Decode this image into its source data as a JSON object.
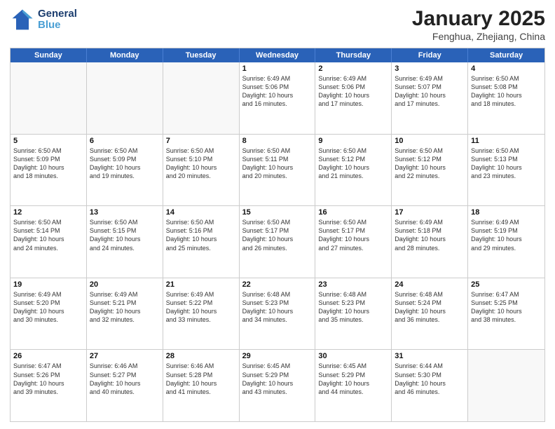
{
  "header": {
    "logo_line1": "General",
    "logo_line2": "Blue",
    "month": "January 2025",
    "location": "Fenghua, Zhejiang, China"
  },
  "weekdays": [
    "Sunday",
    "Monday",
    "Tuesday",
    "Wednesday",
    "Thursday",
    "Friday",
    "Saturday"
  ],
  "rows": [
    [
      {
        "day": "",
        "info": "",
        "empty": true
      },
      {
        "day": "",
        "info": "",
        "empty": true
      },
      {
        "day": "",
        "info": "",
        "empty": true
      },
      {
        "day": "1",
        "info": "Sunrise: 6:49 AM\nSunset: 5:06 PM\nDaylight: 10 hours\nand 16 minutes."
      },
      {
        "day": "2",
        "info": "Sunrise: 6:49 AM\nSunset: 5:06 PM\nDaylight: 10 hours\nand 17 minutes."
      },
      {
        "day": "3",
        "info": "Sunrise: 6:49 AM\nSunset: 5:07 PM\nDaylight: 10 hours\nand 17 minutes."
      },
      {
        "day": "4",
        "info": "Sunrise: 6:50 AM\nSunset: 5:08 PM\nDaylight: 10 hours\nand 18 minutes."
      }
    ],
    [
      {
        "day": "5",
        "info": "Sunrise: 6:50 AM\nSunset: 5:09 PM\nDaylight: 10 hours\nand 18 minutes."
      },
      {
        "day": "6",
        "info": "Sunrise: 6:50 AM\nSunset: 5:09 PM\nDaylight: 10 hours\nand 19 minutes."
      },
      {
        "day": "7",
        "info": "Sunrise: 6:50 AM\nSunset: 5:10 PM\nDaylight: 10 hours\nand 20 minutes."
      },
      {
        "day": "8",
        "info": "Sunrise: 6:50 AM\nSunset: 5:11 PM\nDaylight: 10 hours\nand 20 minutes."
      },
      {
        "day": "9",
        "info": "Sunrise: 6:50 AM\nSunset: 5:12 PM\nDaylight: 10 hours\nand 21 minutes."
      },
      {
        "day": "10",
        "info": "Sunrise: 6:50 AM\nSunset: 5:12 PM\nDaylight: 10 hours\nand 22 minutes."
      },
      {
        "day": "11",
        "info": "Sunrise: 6:50 AM\nSunset: 5:13 PM\nDaylight: 10 hours\nand 23 minutes."
      }
    ],
    [
      {
        "day": "12",
        "info": "Sunrise: 6:50 AM\nSunset: 5:14 PM\nDaylight: 10 hours\nand 24 minutes."
      },
      {
        "day": "13",
        "info": "Sunrise: 6:50 AM\nSunset: 5:15 PM\nDaylight: 10 hours\nand 24 minutes."
      },
      {
        "day": "14",
        "info": "Sunrise: 6:50 AM\nSunset: 5:16 PM\nDaylight: 10 hours\nand 25 minutes."
      },
      {
        "day": "15",
        "info": "Sunrise: 6:50 AM\nSunset: 5:17 PM\nDaylight: 10 hours\nand 26 minutes."
      },
      {
        "day": "16",
        "info": "Sunrise: 6:50 AM\nSunset: 5:17 PM\nDaylight: 10 hours\nand 27 minutes."
      },
      {
        "day": "17",
        "info": "Sunrise: 6:49 AM\nSunset: 5:18 PM\nDaylight: 10 hours\nand 28 minutes."
      },
      {
        "day": "18",
        "info": "Sunrise: 6:49 AM\nSunset: 5:19 PM\nDaylight: 10 hours\nand 29 minutes."
      }
    ],
    [
      {
        "day": "19",
        "info": "Sunrise: 6:49 AM\nSunset: 5:20 PM\nDaylight: 10 hours\nand 30 minutes."
      },
      {
        "day": "20",
        "info": "Sunrise: 6:49 AM\nSunset: 5:21 PM\nDaylight: 10 hours\nand 32 minutes."
      },
      {
        "day": "21",
        "info": "Sunrise: 6:49 AM\nSunset: 5:22 PM\nDaylight: 10 hours\nand 33 minutes."
      },
      {
        "day": "22",
        "info": "Sunrise: 6:48 AM\nSunset: 5:23 PM\nDaylight: 10 hours\nand 34 minutes."
      },
      {
        "day": "23",
        "info": "Sunrise: 6:48 AM\nSunset: 5:23 PM\nDaylight: 10 hours\nand 35 minutes."
      },
      {
        "day": "24",
        "info": "Sunrise: 6:48 AM\nSunset: 5:24 PM\nDaylight: 10 hours\nand 36 minutes."
      },
      {
        "day": "25",
        "info": "Sunrise: 6:47 AM\nSunset: 5:25 PM\nDaylight: 10 hours\nand 38 minutes."
      }
    ],
    [
      {
        "day": "26",
        "info": "Sunrise: 6:47 AM\nSunset: 5:26 PM\nDaylight: 10 hours\nand 39 minutes."
      },
      {
        "day": "27",
        "info": "Sunrise: 6:46 AM\nSunset: 5:27 PM\nDaylight: 10 hours\nand 40 minutes."
      },
      {
        "day": "28",
        "info": "Sunrise: 6:46 AM\nSunset: 5:28 PM\nDaylight: 10 hours\nand 41 minutes."
      },
      {
        "day": "29",
        "info": "Sunrise: 6:45 AM\nSunset: 5:29 PM\nDaylight: 10 hours\nand 43 minutes."
      },
      {
        "day": "30",
        "info": "Sunrise: 6:45 AM\nSunset: 5:29 PM\nDaylight: 10 hours\nand 44 minutes."
      },
      {
        "day": "31",
        "info": "Sunrise: 6:44 AM\nSunset: 5:30 PM\nDaylight: 10 hours\nand 46 minutes."
      },
      {
        "day": "",
        "info": "",
        "empty": true
      }
    ]
  ]
}
